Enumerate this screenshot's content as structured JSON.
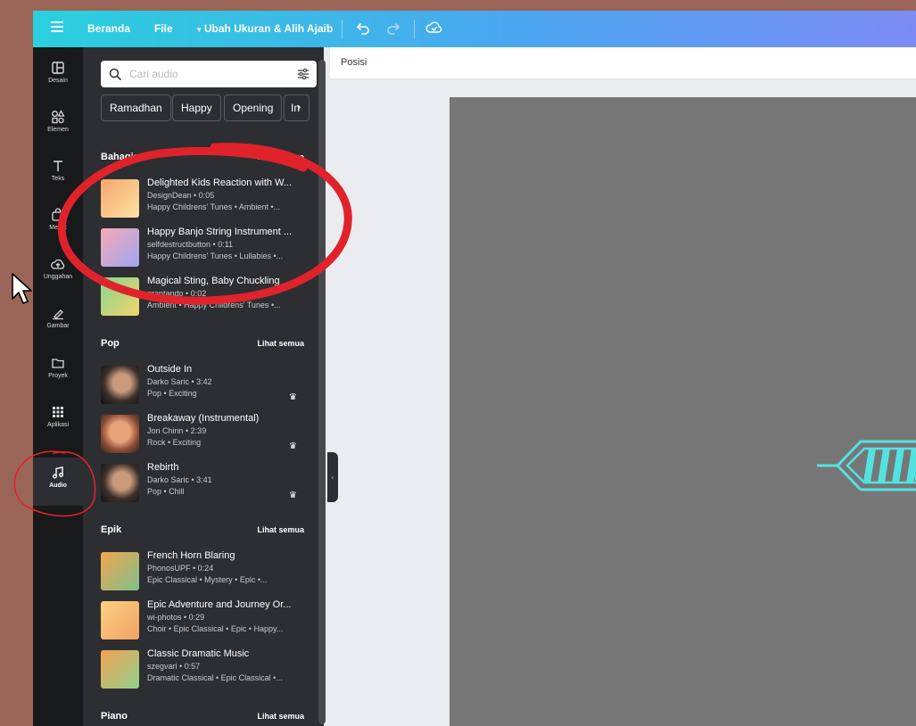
{
  "topbar": {
    "home_label": "Beranda",
    "file_label": "File",
    "resize_label": "Ubah Ukuran & Alih Ajaib"
  },
  "rail": {
    "items": [
      {
        "label": "Desain",
        "icon": "layout-icon"
      },
      {
        "label": "Elemen",
        "icon": "shapes-icon"
      },
      {
        "label": "Teks",
        "icon": "text-icon"
      },
      {
        "label": "Merek",
        "icon": "brand-icon"
      },
      {
        "label": "Unggahan",
        "icon": "cloud-upload-icon"
      },
      {
        "label": "Gambar",
        "icon": "draw-icon"
      },
      {
        "label": "Proyek",
        "icon": "folder-icon"
      },
      {
        "label": "Aplikasi",
        "icon": "apps-grid-icon"
      },
      {
        "label": "Audio",
        "icon": "music-note-icon"
      }
    ],
    "active": "Audio"
  },
  "search": {
    "placeholder": "Cari audio"
  },
  "chips": [
    "Ramadhan",
    "Happy",
    "Opening",
    "In"
  ],
  "see_all": "Lihat semua",
  "sections": [
    {
      "title": "Bahagia",
      "tracks": [
        {
          "title": "Delighted Kids Reaction with W...",
          "meta": "DesignDean • 0:05",
          "tags": "Happy Childrens' Tunes • Ambient •...",
          "premium": false
        },
        {
          "title": "Happy Banjo String Instrument ...",
          "meta": "selfdestructbutton • 0:11",
          "tags": "Happy Childrens' Tunes • Lullabies •...",
          "premium": false
        },
        {
          "title": "Magical Sting, Baby Chuckling",
          "meta": "grantando • 0:02",
          "tags": "Ambient • Happy Childrens' Tunes •...",
          "premium": false
        }
      ]
    },
    {
      "title": "Pop",
      "tracks": [
        {
          "title": "Outside In",
          "meta": "Darko Saric • 3:42",
          "tags": "Pop • Exciting",
          "premium": true
        },
        {
          "title": "Breakaway (Instrumental)",
          "meta": "Jon Chinn • 2:39",
          "tags": "Rock • Exciting",
          "premium": true
        },
        {
          "title": "Rebirth",
          "meta": "Darko Saric • 3:41",
          "tags": "Pop • Chill",
          "premium": true
        }
      ]
    },
    {
      "title": "Epik",
      "tracks": [
        {
          "title": "French Horn Blaring",
          "meta": "PhonosUPF • 0:24",
          "tags": "Epic Classical • Mystery • Epic •...",
          "premium": false
        },
        {
          "title": "Epic Adventure and Journey Or...",
          "meta": "wi-photos • 0:29",
          "tags": "Choir • Epic Classical • Epic • Happy...",
          "premium": false
        },
        {
          "title": "Classic Dramatic Music",
          "meta": "szegvari • 0:57",
          "tags": "Dramatic Classical • Epic Classical •...",
          "premium": false
        }
      ]
    },
    {
      "title": "Piano",
      "tracks": []
    }
  ],
  "context_bar": {
    "label": "Posisi"
  },
  "colors": {
    "topbar_start": "#2ad0dd",
    "topbar_end": "#7b8cf4",
    "rail_bg": "#18191b",
    "panel_bg": "#2d2e31",
    "canvas_bg": "#767676",
    "accent_cyan": "#52e3e1",
    "annotation_red": "#e0232a"
  }
}
